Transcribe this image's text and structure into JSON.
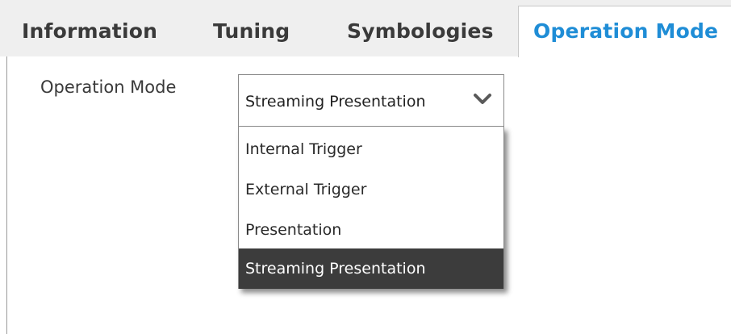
{
  "tabs": [
    {
      "label": "Information"
    },
    {
      "label": "Tuning"
    },
    {
      "label": "Symbologies"
    },
    {
      "label": "Operation Mode",
      "active": true
    }
  ],
  "field": {
    "label": "Operation Mode",
    "selected": "Streaming Presentation"
  },
  "dropdown": {
    "options": [
      {
        "label": "Internal Trigger"
      },
      {
        "label": "External Trigger"
      },
      {
        "label": "Presentation"
      },
      {
        "label": "Streaming Presentation",
        "highlighted": true
      }
    ]
  },
  "colors": {
    "active_tab_text": "#1f8dd6",
    "tab_bar_bg": "#efefef",
    "highlight_bg": "#3c3c3c"
  },
  "icons": {
    "select_chevron": "chevron-down-icon"
  }
}
